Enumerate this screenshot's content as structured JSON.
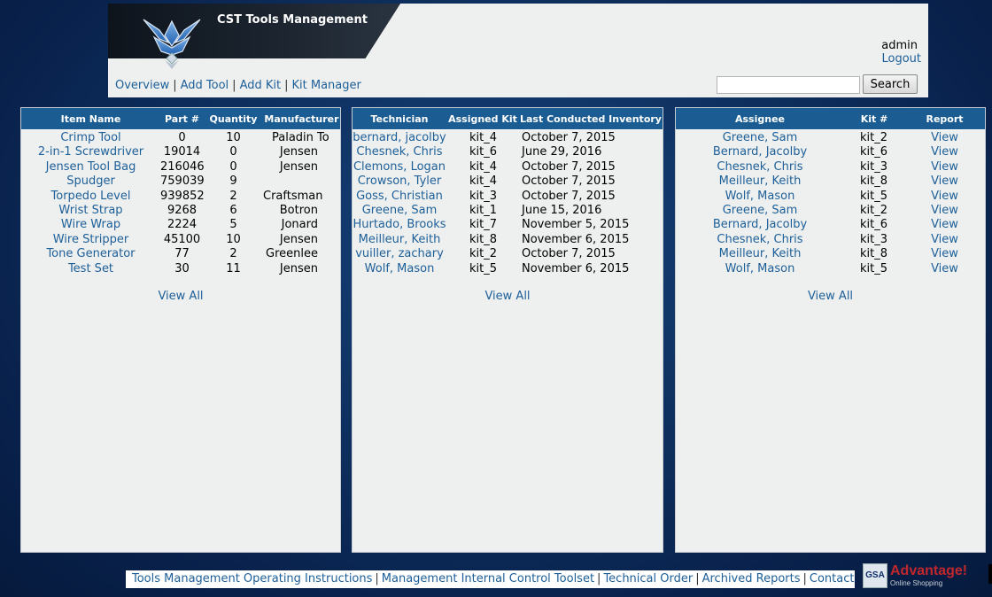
{
  "header": {
    "app_title": "CST Tools Management",
    "user": "admin",
    "logout_label": "Logout",
    "logo_icon": "air-force-wings-icon"
  },
  "nav": {
    "items": [
      "Overview",
      "Add Tool",
      "Add Kit",
      "Kit Manager"
    ],
    "separator": "|"
  },
  "search": {
    "value": "",
    "button_label": "Search"
  },
  "tools_panel": {
    "columns": [
      "Item Name",
      "Part #",
      "Quantity",
      "Manufacturer"
    ],
    "rows": [
      {
        "name": "Crimp Tool",
        "part": "0",
        "qty": "10",
        "mfr": "Paladin To"
      },
      {
        "name": "2-in-1 Screwdriver",
        "part": "19014",
        "qty": "0",
        "mfr": "Jensen"
      },
      {
        "name": "Jensen Tool Bag",
        "part": "216046",
        "qty": "0",
        "mfr": "Jensen"
      },
      {
        "name": "Spudger",
        "part": "759039",
        "qty": "9",
        "mfr": ""
      },
      {
        "name": "Torpedo Level",
        "part": "939852",
        "qty": "2",
        "mfr": "Craftsman"
      },
      {
        "name": "Wrist Strap",
        "part": "9268",
        "qty": "6",
        "mfr": "Botron"
      },
      {
        "name": "Wire Wrap",
        "part": "2224",
        "qty": "5",
        "mfr": "Jonard"
      },
      {
        "name": "Wire Stripper",
        "part": "45100",
        "qty": "10",
        "mfr": "Jensen"
      },
      {
        "name": "Tone Generator",
        "part": "77",
        "qty": "2",
        "mfr": "Greenlee"
      },
      {
        "name": "Test Set",
        "part": "30",
        "qty": "11",
        "mfr": "Jensen"
      }
    ],
    "view_all_label": "View All"
  },
  "tech_panel": {
    "columns": [
      "Technician",
      "Assigned Kit",
      "Last Conducted Inventory"
    ],
    "rows": [
      {
        "tech": "bernard, jacolby",
        "kit": "kit_4",
        "date": "October 7, 2015"
      },
      {
        "tech": "Chesnek, Chris",
        "kit": "kit_6",
        "date": "June 29, 2016"
      },
      {
        "tech": "Clemons, Logan",
        "kit": "kit_4",
        "date": "October 7, 2015"
      },
      {
        "tech": "Crowson, Tyler",
        "kit": "kit_4",
        "date": "October 7, 2015"
      },
      {
        "tech": "Goss, Christian",
        "kit": "kit_3",
        "date": "October 7, 2015"
      },
      {
        "tech": "Greene, Sam",
        "kit": "kit_1",
        "date": "June 15, 2016"
      },
      {
        "tech": "Hurtado, Brooks",
        "kit": "kit_7",
        "date": "November 5, 2015"
      },
      {
        "tech": "Meilleur, Keith",
        "kit": "kit_8",
        "date": "November 6, 2015"
      },
      {
        "tech": "vuiller, zachary",
        "kit": "kit_2",
        "date": "October 7, 2015"
      },
      {
        "tech": "Wolf, Mason",
        "kit": "kit_5",
        "date": "November 6, 2015"
      }
    ],
    "view_all_label": "View All"
  },
  "assign_panel": {
    "columns": [
      "Assignee",
      "Kit #",
      "Report"
    ],
    "rows": [
      {
        "assignee": "Greene, Sam",
        "kit": "kit_2",
        "report": "View"
      },
      {
        "assignee": "Bernard, Jacolby",
        "kit": "kit_6",
        "report": "View"
      },
      {
        "assignee": "Chesnek, Chris",
        "kit": "kit_3",
        "report": "View"
      },
      {
        "assignee": "Meilleur, Keith",
        "kit": "kit_8",
        "report": "View"
      },
      {
        "assignee": "Wolf, Mason",
        "kit": "kit_5",
        "report": "View"
      },
      {
        "assignee": "Greene, Sam",
        "kit": "kit_2",
        "report": "View"
      },
      {
        "assignee": "Bernard, Jacolby",
        "kit": "kit_6",
        "report": "View"
      },
      {
        "assignee": "Chesnek, Chris",
        "kit": "kit_3",
        "report": "View"
      },
      {
        "assignee": "Meilleur, Keith",
        "kit": "kit_8",
        "report": "View"
      },
      {
        "assignee": "Wolf, Mason",
        "kit": "kit_5",
        "report": "View"
      }
    ],
    "view_all_label": "View All"
  },
  "footer": {
    "links": [
      "Tools Management Operating Instructions",
      "Management Internal Control Toolset",
      "Technical Order",
      "Archived Reports",
      "Contact"
    ],
    "separator": "|"
  },
  "gsa_badge": {
    "box_text": "GSA",
    "brand": "Advantage!",
    "tagline": "Online Shopping"
  },
  "colors": {
    "panel_header": "#1b5d92",
    "link": "#1d5f99",
    "background": "#0e2f5e"
  }
}
